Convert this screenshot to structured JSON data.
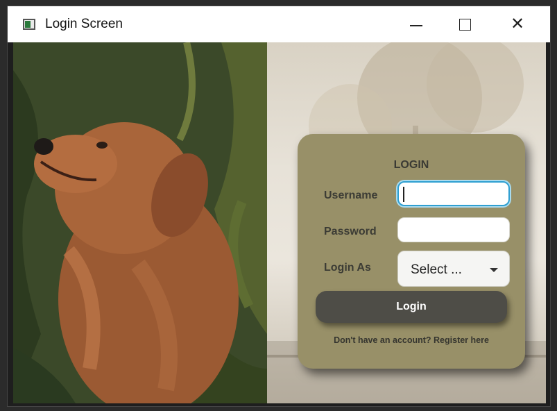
{
  "window": {
    "title": "Login Screen",
    "controls": {
      "minimize": "—",
      "maximize": "☐",
      "close": "✕"
    }
  },
  "login": {
    "heading": "LOGIN",
    "username_label": "Username",
    "username_value": "",
    "password_label": "Password",
    "password_value": "",
    "login_as_label": "Login As",
    "login_as_selected": "Select ...",
    "login_button": "Login",
    "register_text": "Don't have an account? Register here"
  },
  "colors": {
    "card": "#989068",
    "button": "#4e4d47",
    "focus": "#2f9fd1"
  },
  "icons": [
    "app-icon",
    "minimize-icon",
    "maximize-icon",
    "close-icon",
    "chevron-down-icon"
  ]
}
